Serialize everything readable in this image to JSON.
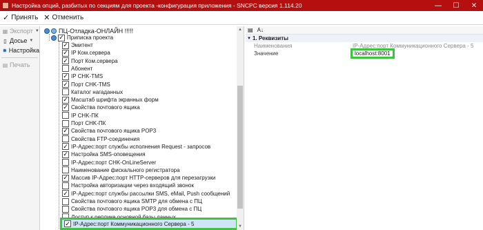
{
  "window": {
    "title": "Настройка опций, разбитых по секциям для  проекта -конфигурация приложения - SNCPC версия 1.114.20",
    "controls": [
      "—",
      "☐",
      "✕"
    ]
  },
  "toolbar": {
    "accept_label": "Принять",
    "cancel_label": "Отменить"
  },
  "left_panel": {
    "export_label": "Экспорт",
    "dossier_label": "Досье",
    "settings_label": "Настройка",
    "print_label": "Печать"
  },
  "tree": {
    "root_label": "ПЦ-Отладка-ОНЛАЙН !!!!!",
    "project_label": "Приписка проекта",
    "items": [
      {
        "label": "Эмитент",
        "checked": true
      },
      {
        "label": "IP Ком.сервера",
        "checked": true
      },
      {
        "label": "Порт Ком.сервера",
        "checked": true
      },
      {
        "label": "Абонент",
        "checked": false
      },
      {
        "label": "IP  CHK-TMS",
        "checked": true
      },
      {
        "label": "Порт CHK-TMS",
        "checked": true
      },
      {
        "label": "Каталог нагаданных",
        "checked": false
      },
      {
        "label": "Масштаб шрифта экранных форм",
        "checked": true
      },
      {
        "label": "Свойства почтового ящика",
        "checked": true
      },
      {
        "label": "IP CHK-ПК",
        "checked": false
      },
      {
        "label": "Порт CHK-ПК",
        "checked": false
      },
      {
        "label": "Свойства почтового ящика POP3",
        "checked": true
      },
      {
        "label": "Свойства FTP-соединения",
        "checked": false
      },
      {
        "label": "IP-Адрес:порт службы исполнения Request - запросов",
        "checked": true
      },
      {
        "label": "Настройка SMS-оповещения",
        "checked": true
      },
      {
        "label": "IP-Адрес:порт CHK-OnLineServer",
        "checked": false
      },
      {
        "label": "Наименование фискального регистратора",
        "checked": false
      },
      {
        "label": "Массив IP-Адрес:порт HTTP-серверов для перезагрузки",
        "checked": true
      },
      {
        "label": "Настройка авторизации через входящий звонок",
        "checked": false
      },
      {
        "label": "IP-Адрес:порт службы рассылки SMS, eMail, Push сообщений",
        "checked": true
      },
      {
        "label": "Свойства почтового ящика SMTP для обмена с ПЦ",
        "checked": false
      },
      {
        "label": "Свойства почтового ящика POP3 для обмена с ПЦ",
        "checked": false
      },
      {
        "label": "Доступ к реплике основной базы данных",
        "checked": false
      }
    ],
    "selected_label": "IP-Адрес:порт Коммуникационного Сервера - 5"
  },
  "property_grid": {
    "category": "1. Реквизиты",
    "name_label": "Наименования",
    "name_value": "IP-Адрес:порт Коммуникационного Сервера - 5",
    "value_label": "Значение",
    "value_value": "localhost:8001"
  },
  "colors": {
    "titlebar": "#b60f0f",
    "highlight": "#3cc43c",
    "selection": "#cfe4f8"
  }
}
